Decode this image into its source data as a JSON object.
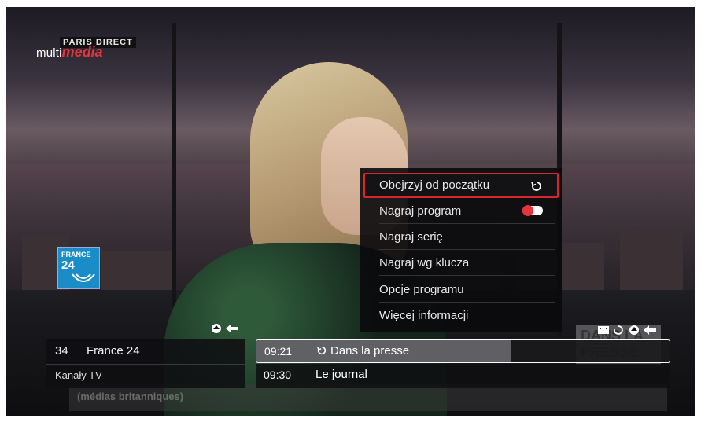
{
  "overlay": {
    "logo_small": "multi",
    "logo_big": "media",
    "channel_bug": "PARIS DIRECT",
    "channel_logo_line1": "FRANCE",
    "channel_logo_line2": "24"
  },
  "context_menu": {
    "items": [
      {
        "label": "Obejrzyj od początku",
        "icon": "restart-icon",
        "selected": true
      },
      {
        "label": "Nagraj program",
        "icon": "record-toggle-icon",
        "selected": false
      },
      {
        "label": "Nagraj serię",
        "icon": "",
        "selected": false
      },
      {
        "label": "Nagraj wg klucza",
        "icon": "",
        "selected": false
      },
      {
        "label": "Opcje programu",
        "icon": "",
        "selected": false
      },
      {
        "label": "Więcej informacji",
        "icon": "",
        "selected": false
      }
    ]
  },
  "channel_bar": {
    "number": "34",
    "name": "France 24",
    "category": "Kanały TV"
  },
  "programs": [
    {
      "time": "09:21",
      "title": "Dans la presse",
      "icon": "restart-icon",
      "progress": 0.617
    },
    {
      "time": "09:30",
      "title": "Le journal"
    }
  ],
  "background": {
    "ticker_text": "(médias britanniques)",
    "lower_third": "DANS LA PRESSE"
  },
  "colors": {
    "accent": "#d8262e",
    "menu_bg": "#0a0a0c",
    "text": "#e8e8e8"
  }
}
